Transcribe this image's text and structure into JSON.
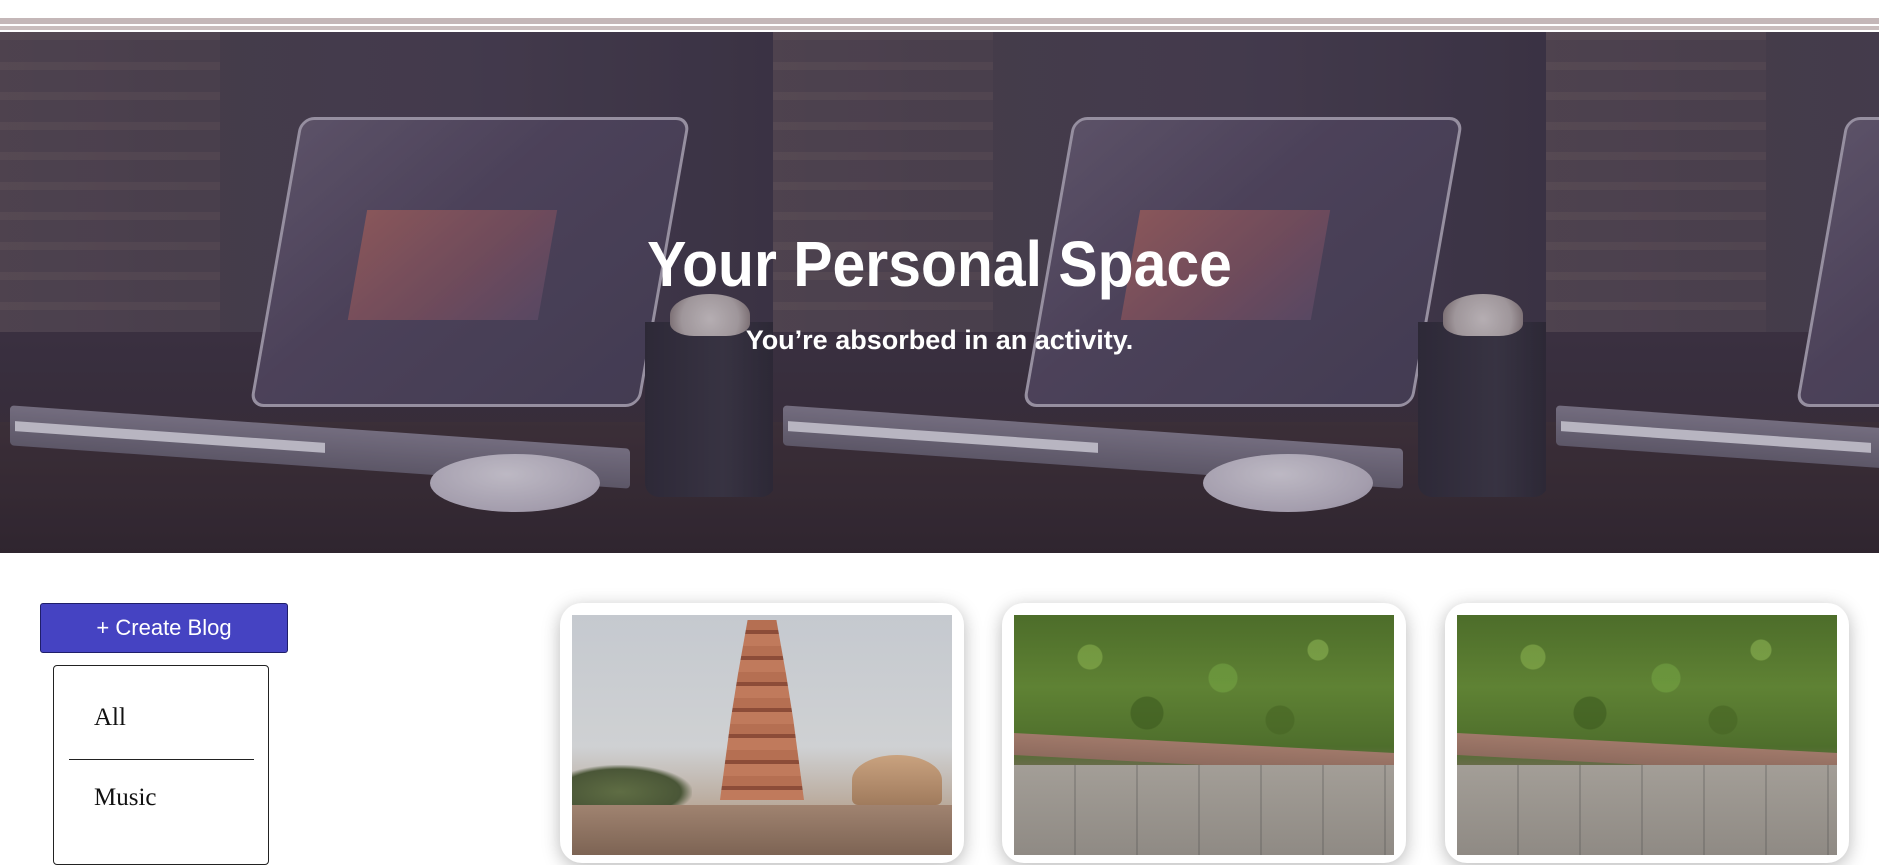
{
  "hero": {
    "title": "Your Personal Space",
    "subtitle": "You’re absorbed in an activity."
  },
  "sidebar": {
    "create_button_label": "+ Create Blog",
    "categories": [
      {
        "label": "All"
      },
      {
        "label": "Music"
      }
    ]
  },
  "cards": [
    {
      "image": "tower-photo"
    },
    {
      "image": "hedge-photo"
    },
    {
      "image": "hedge-photo"
    }
  ],
  "colors": {
    "create_button": "#4543c2",
    "hero_text": "#ffffff"
  }
}
